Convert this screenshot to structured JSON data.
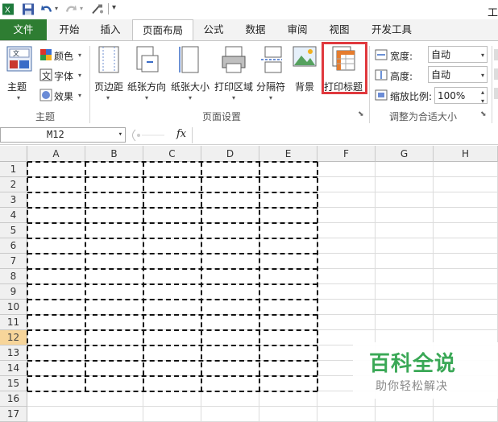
{
  "app": {
    "title_partial": "工"
  },
  "qat": {
    "undo_icon": "undo-icon",
    "redo_icon": "redo-icon",
    "save_icon": "save-icon",
    "customize": "▾"
  },
  "tabs": {
    "file": "文件",
    "home": "开始",
    "insert": "插入",
    "page_layout": "页面布局",
    "formulas": "公式",
    "data": "数据",
    "review": "审阅",
    "view": "视图",
    "developer": "开发工具"
  },
  "ribbon": {
    "themes": {
      "themes_btn": "主题",
      "colors_btn": "颜色",
      "fonts_btn": "字体",
      "effects_btn": "效果",
      "group_label": "主题"
    },
    "page_setup": {
      "margins": "页边距",
      "orientation": "纸张方向",
      "size": "纸张大小",
      "print_area": "打印区域",
      "breaks": "分隔符",
      "background": "背景",
      "print_titles": "打印标题",
      "group_label": "页面设置"
    },
    "scale_to_fit": {
      "width_label": "宽度:",
      "width_value": "自动",
      "height_label": "高度:",
      "height_value": "自动",
      "scale_label": "缩放比例:",
      "scale_value": "100%",
      "group_label": "调整为合适大小"
    }
  },
  "formula_bar": {
    "name_box": "M12",
    "fx": "fx"
  },
  "sheet": {
    "columns": [
      "A",
      "B",
      "C",
      "D",
      "E",
      "F",
      "G",
      "H"
    ],
    "rows": [
      "1",
      "2",
      "3",
      "4",
      "5",
      "6",
      "7",
      "8",
      "9",
      "10",
      "11",
      "12",
      "13",
      "14",
      "15",
      "16",
      "17"
    ],
    "selected_row": "12"
  },
  "watermark": {
    "title": "百科全说",
    "subtitle": "助你轻松解决"
  },
  "colors": {
    "file_tab": "#2e7d32",
    "highlight": "#e0393e",
    "selected_row_header": "#f7d59a",
    "watermark_green": "#3aa856"
  }
}
